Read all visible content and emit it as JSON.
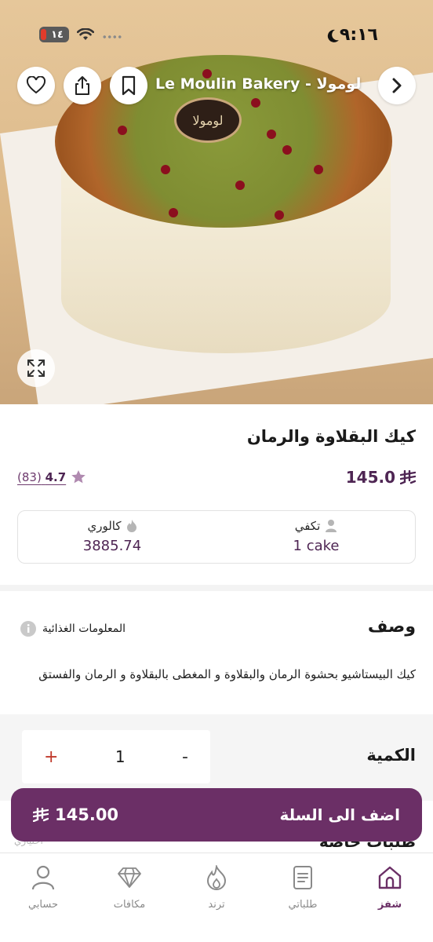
{
  "status_bar": {
    "time": "٩:١٦",
    "battery": "١٤"
  },
  "header": {
    "store_name": "Le Moulin Bakery - لوموﻻ",
    "cake_logo_text": "لوموﻻ"
  },
  "product": {
    "title": "كيك البقلاوة والرمان",
    "price": "145.0",
    "currency_symbol": "⃁",
    "rating": "4.7",
    "rating_count": "(83)",
    "serves_label": "تكفي",
    "serves_value": "1 cake",
    "calories_label": "كالوري",
    "calories_value": "3885.74"
  },
  "description": {
    "heading": "وصف",
    "nutrition_link": "المعلومات الغذائية",
    "text": "كيك البيستاشيو بحشوة الرمان والبقلاوة و المغطى بالبقلاوة و الرمان والفستق"
  },
  "quantity": {
    "label": "الكمية",
    "value": "1",
    "plus": "+",
    "minus": "-"
  },
  "below_fold": {
    "heading": "طلبات خاصة",
    "note": "اختياري"
  },
  "cart": {
    "label": "اضف الى السلة",
    "total": "145.00"
  },
  "tabs": [
    {
      "label": "شفز",
      "icon": "home-icon",
      "active": true
    },
    {
      "label": "طلباتي",
      "icon": "orders-icon",
      "active": false
    },
    {
      "label": "ترند",
      "icon": "flame-icon",
      "active": false
    },
    {
      "label": "مكافات",
      "icon": "diamond-icon",
      "active": false
    },
    {
      "label": "حسابي",
      "icon": "user-icon",
      "active": false
    }
  ],
  "colors": {
    "brand": "#6b2f66",
    "price": "#4e2553",
    "plus": "#c0392b"
  }
}
